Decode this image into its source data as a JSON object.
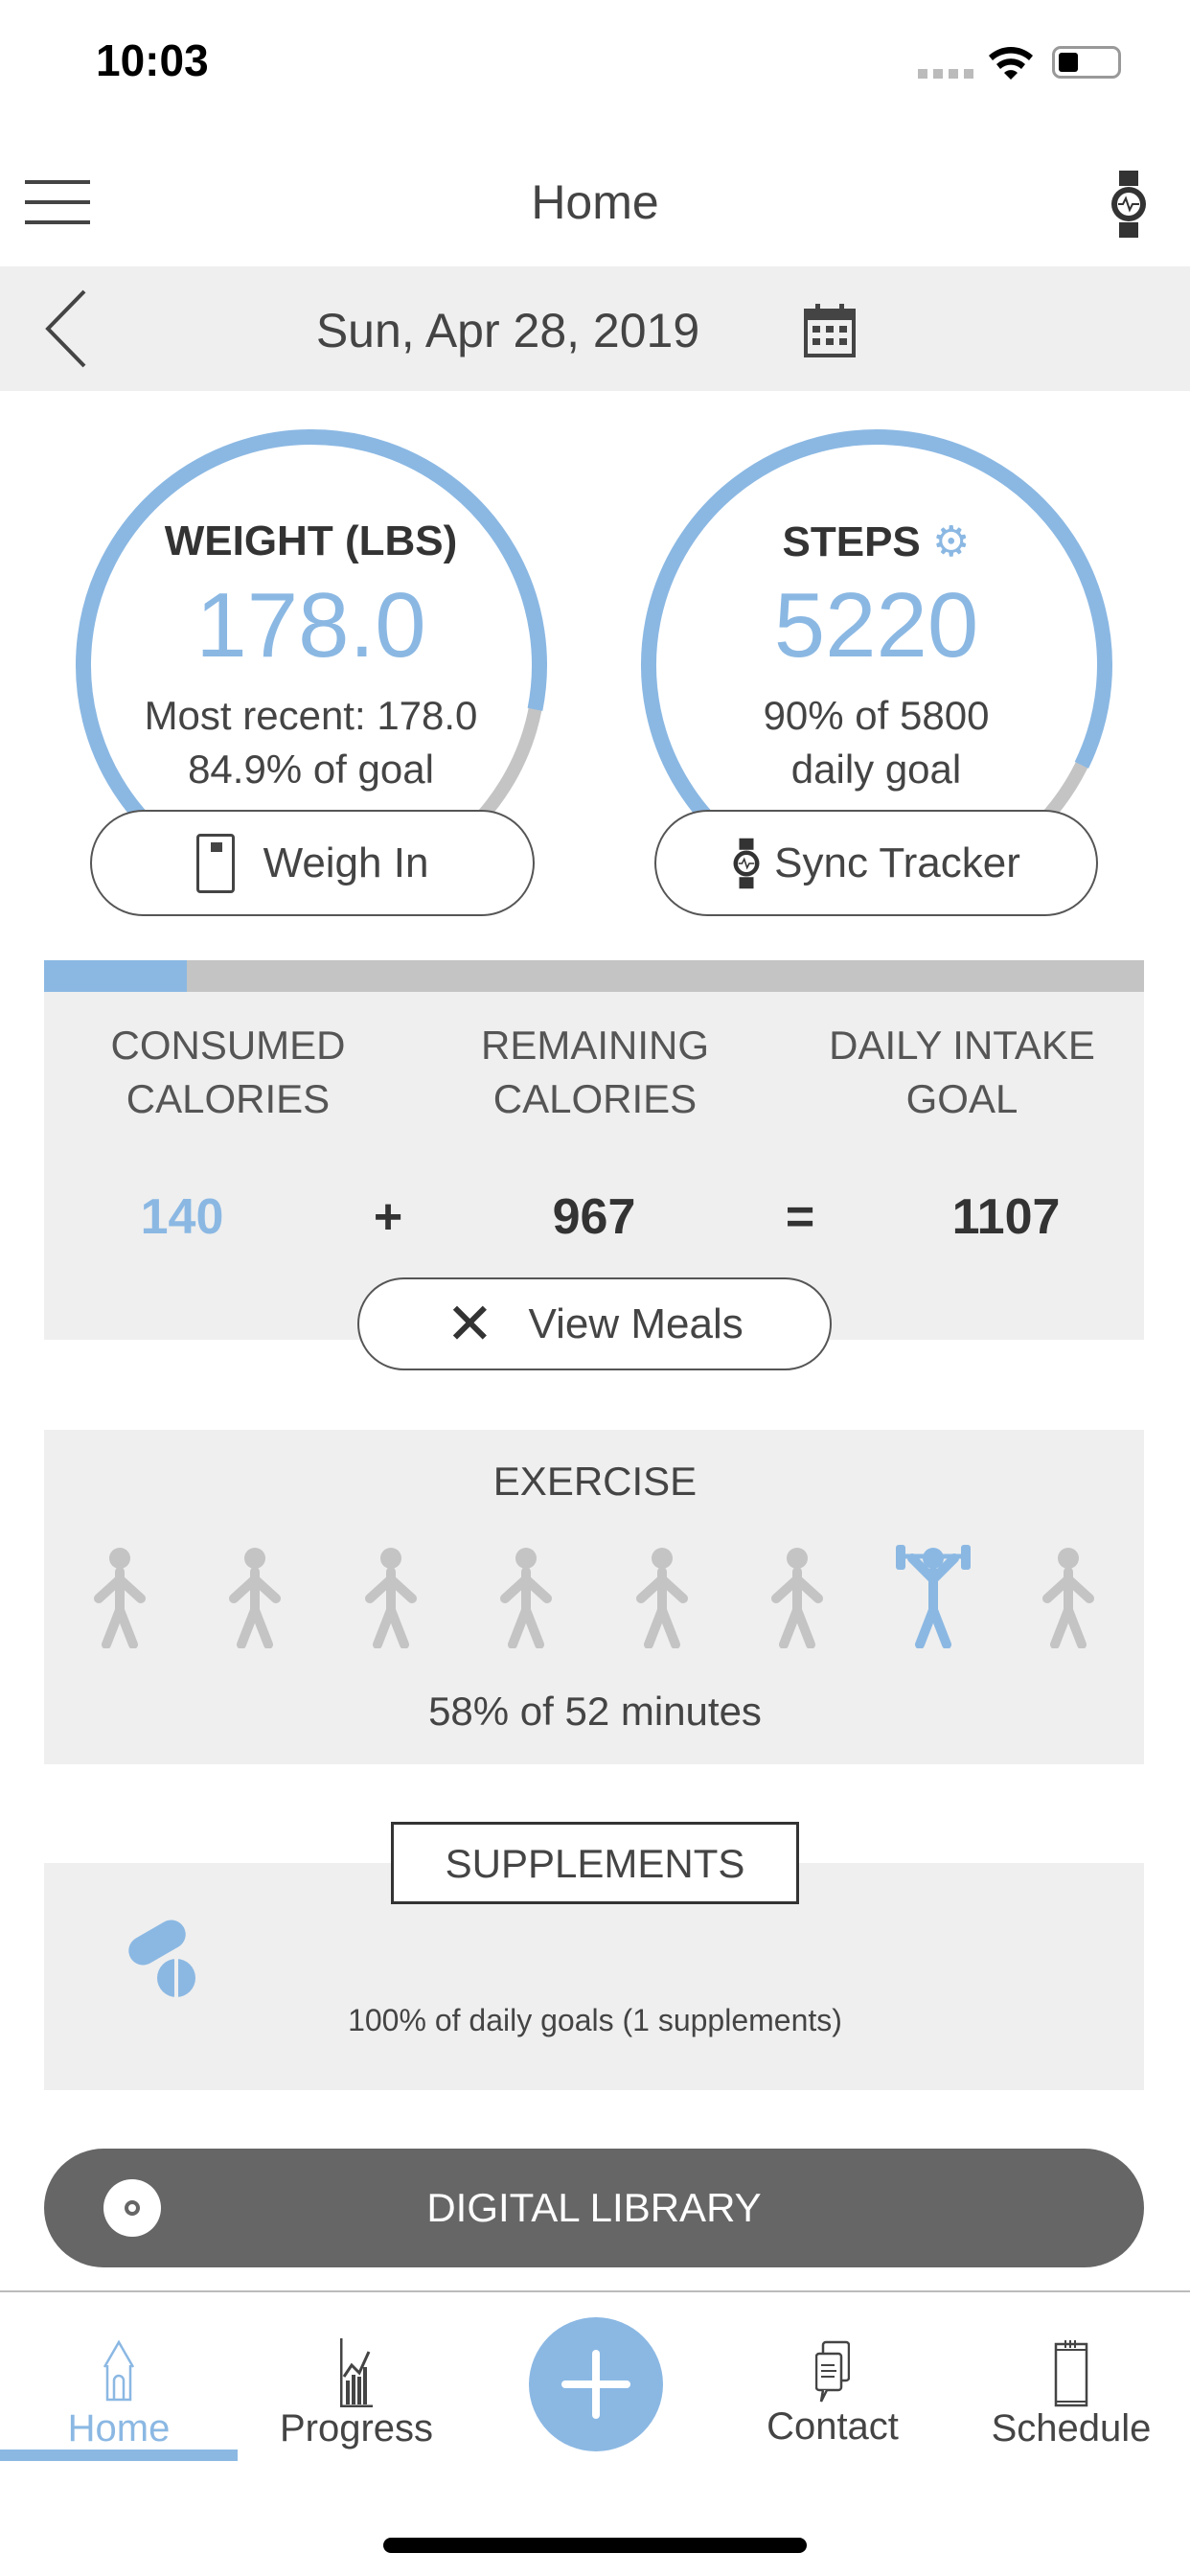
{
  "status": {
    "time": "10:03"
  },
  "header": {
    "title": "Home",
    "menu_icon": "hamburger-icon",
    "tracker_icon": "watch-icon"
  },
  "date_bar": {
    "date": "Sun, Apr 28, 2019",
    "back_icon": "chevron-left-icon",
    "calendar_icon": "calendar-icon"
  },
  "weight": {
    "title": "WEIGHT (LBS)",
    "value": "178.0",
    "line1": "Most recent: 178.0",
    "line2": "84.9% of goal",
    "progress": 0.849,
    "button": "Weigh In"
  },
  "steps": {
    "title": "STEPS",
    "value": "5220",
    "line1": "90% of 5800",
    "line2": "daily goal",
    "progress": 0.9,
    "button": "Sync Tracker"
  },
  "calories": {
    "progress": 0.13,
    "consumed_label": "CONSUMED CALORIES",
    "remaining_label": "REMAINING CALORIES",
    "goal_label": "DAILY INTAKE GOAL",
    "consumed": "140",
    "plus": "+",
    "remaining": "967",
    "equals": "=",
    "goal": "1107",
    "button": "View Meals"
  },
  "exercise": {
    "title": "EXERCISE",
    "summary": "58% of 52 minutes",
    "icons": [
      "step-aerobics-icon",
      "cycling-icon",
      "walking-icon",
      "swimming-icon",
      "running-icon",
      "soccer-icon",
      "weightlifting-icon",
      "yoga-icon"
    ],
    "active_index": 6
  },
  "supplements": {
    "title": "SUPPLEMENTS",
    "summary": "100% of daily goals (1 supplements)"
  },
  "library": {
    "label": "DIGITAL LIBRARY"
  },
  "tabs": [
    {
      "label": "Home",
      "active": true
    },
    {
      "label": "Progress"
    },
    {
      "label": ""
    },
    {
      "label": "Contact"
    },
    {
      "label": "Schedule"
    }
  ],
  "colors": {
    "accent": "#8bb8e3",
    "track": "#c4c4c4",
    "panel": "#efefef",
    "library": "#666666"
  }
}
